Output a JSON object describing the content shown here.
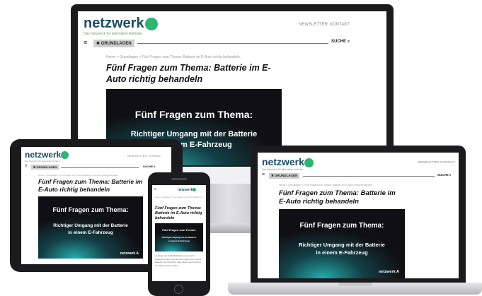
{
  "site": {
    "logo_text": "netzwerk",
    "logo_letter": "A",
    "tagline": "Das Netzwerk für alternative Antriebe",
    "nav_newsletter": "NEWSLETTER",
    "nav_kontakt": "KONTAKT",
    "tab_label": "GRUNDLAGEN",
    "search_label": "SUCHE",
    "breadcrumb": "Home > Grundlagen > Fünf Fragen zum Thema: Batterie im E-Auto richtig behandeln",
    "title": "Fünf Fragen zum Thema: Batterie im E-Auto richtig behandeln",
    "hero_line1": "Fünf Fragen zum Thema:",
    "hero_line2": "Richtiger Umgang mit der Batterie",
    "hero_line3": "in einem E-Fahrzeug",
    "hero_brand": "netzwerk A",
    "phone_text": "Je länger die E-Mobilität läuft, umso mehr Antworten finden sich auf die Fragen zum Thema Batterie. Ein Überblick, was Halter eines E-Autos zur Pflege wissen sollten."
  },
  "colors": {
    "brand_blue": "#1d4d66",
    "brand_green": "#2bb673",
    "frame": "#1b1b1d",
    "hero_bg": "#101014",
    "hero_glow": "#28c8c8"
  },
  "icons": {
    "menu": "hamburger-icon",
    "search": "search-icon",
    "tab_close": "close-icon"
  }
}
